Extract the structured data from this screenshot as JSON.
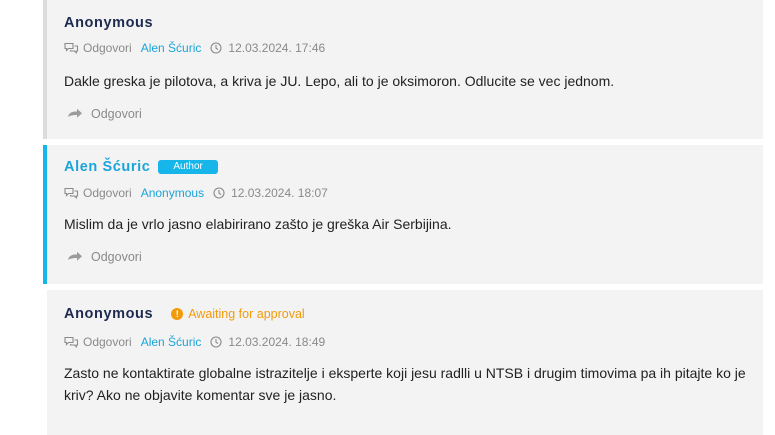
{
  "comments": [
    {
      "author": "Anonymous",
      "meta": {
        "reply_label": "Odgovori",
        "reply_to": "Alen Šćuric",
        "datetime": "12.03.2024. 17:46"
      },
      "text": "Dakle greska je pilotova, a kriva je JU. Lepo, ali to je oksimoron. Odlucite se vec jednom.",
      "reply_button": "Odgovori"
    },
    {
      "author": "Alen Šćuric",
      "badge": "Author",
      "meta": {
        "reply_label": "Odgovori",
        "reply_to": "Anonymous",
        "datetime": "12.03.2024. 18:07"
      },
      "text": "Mislim da je vrlo jasno elabirirano zašto je greška Air Serbijina.",
      "reply_button": "Odgovori"
    },
    {
      "author": "Anonymous",
      "status": "Awaiting for approval",
      "meta": {
        "reply_label": "Odgovori",
        "reply_to": "Alen Šćuric",
        "datetime": "12.03.2024. 18:49"
      },
      "text": "Zasto ne kontaktirate globalne istrazitelje i eksperte koji jesu radlli u NTSB i drugim timovima pa ih pitajte ko je kriv? Ako ne objavite komentar sve je jasno."
    }
  ],
  "colors": {
    "accent": "#16b5ea",
    "author_dark": "#1e2b4f",
    "warning": "#f29b0a",
    "card_bg": "#f3f3f3"
  },
  "icons": {
    "meta_reply": "speech-bubbles-icon",
    "meta_time": "clock-icon",
    "reply_action": "reply-arrow-icon",
    "status": "exclamation-circle-icon"
  }
}
